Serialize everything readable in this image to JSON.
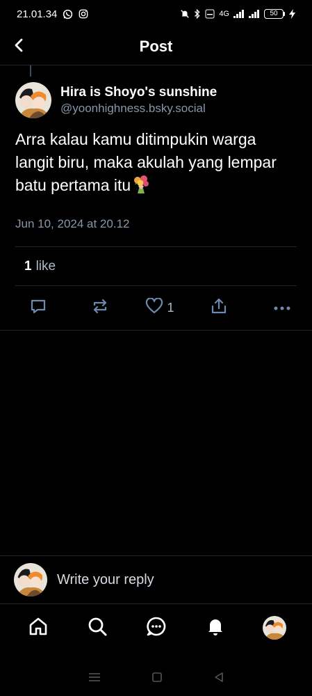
{
  "status_bar": {
    "time": "21.01.34",
    "network": "4G",
    "battery": "50"
  },
  "header": {
    "title": "Post"
  },
  "post": {
    "display_name": "Hira is Shoyo's sunshine",
    "handle": "@yoonhighness.bsky.social",
    "text": "Arra kalau kamu ditimpukin warga langit biru, maka akulah yang lempar batu pertama itu",
    "emoji": "bouquet-emoji",
    "timestamp": "Jun 10, 2024 at 20.12",
    "likes_count": "1",
    "likes_label": "like",
    "actions": {
      "like_count": "1"
    }
  },
  "reply": {
    "placeholder": "Write your reply"
  },
  "nav": {
    "items": [
      "home-icon",
      "search-icon",
      "chat-icon",
      "notifications-icon",
      "profile-avatar"
    ]
  },
  "colors": {
    "background": "#000000",
    "secondary_text": "#8796a8",
    "divider": "#1e2733"
  }
}
